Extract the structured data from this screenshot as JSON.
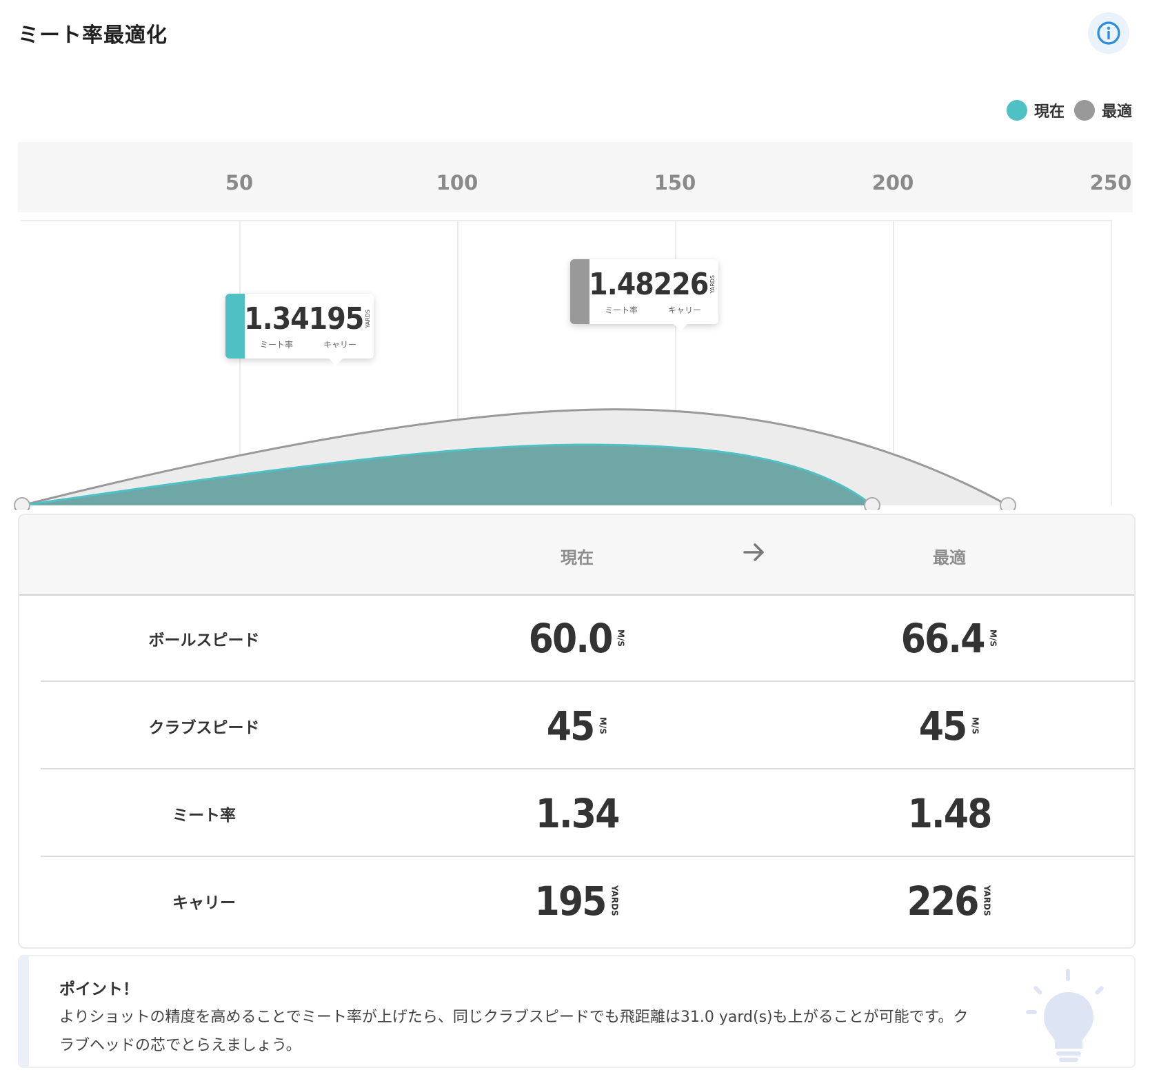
{
  "header": {
    "title": "ミート率最適化",
    "info_icon": "info-icon"
  },
  "legend": [
    {
      "label": "現在",
      "color": "#4fc0c4"
    },
    {
      "label": "最適",
      "color": "#999999"
    }
  ],
  "chart_data": {
    "type": "area",
    "x_ticks": [
      "50",
      "100",
      "150",
      "200",
      "250"
    ],
    "series": [
      {
        "name": "現在",
        "meet_rate": "1.34",
        "carry": "195",
        "color": "#4fc0c4"
      },
      {
        "name": "最適",
        "meet_rate": "1.48",
        "carry": "226",
        "color": "#999999"
      }
    ],
    "tooltip_labels": {
      "meet_rate": "ミート率",
      "carry": "キャリー",
      "unit": "YARDS"
    }
  },
  "table": {
    "head": {
      "current": "現在",
      "optimal": "最適"
    },
    "rows": [
      {
        "label": "ボールスピード",
        "current": "60.0",
        "optimal": "66.4",
        "unit": "M/S"
      },
      {
        "label": "クラブスピード",
        "current": "45",
        "optimal": "45",
        "unit": "M/S"
      },
      {
        "label": "ミート率",
        "current": "1.34",
        "optimal": "1.48",
        "unit": ""
      },
      {
        "label": "キャリー",
        "current": "195",
        "optimal": "226",
        "unit": "YARDS"
      }
    ]
  },
  "point": {
    "title": "ポイント！",
    "body": "よりショットの精度を高めることでミート率が上げたら、同じクラブスピードでも飛距離は31.0 yard(s)も上がることが可能です。クラブヘッドの芯でとらえましょう。"
  }
}
